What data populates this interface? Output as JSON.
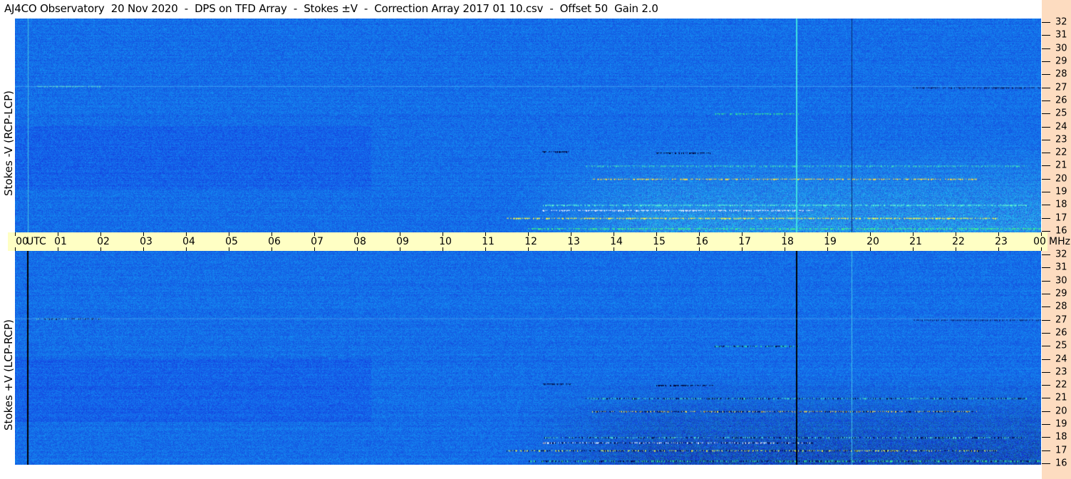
{
  "title": "AJ4CO Observatory  20 Nov 2020  -  DPS on TFD Array  -  Stokes ±V  -  Correction Array 2017 01 10.csv  -  Offset 50  Gain 2.0",
  "chart_data": [
    {
      "type": "heatmap",
      "ylabel": "Stokes -V (RCP-LCP)",
      "x_ticks": [
        "00",
        "01",
        "02",
        "03",
        "04",
        "05",
        "06",
        "07",
        "08",
        "09",
        "10",
        "11",
        "12",
        "13",
        "14",
        "15",
        "16",
        "17",
        "18",
        "19",
        "20",
        "21",
        "22",
        "23",
        "00"
      ],
      "x_unit": "UTC",
      "xlim": [
        "00",
        "24"
      ],
      "y_ticks": [
        32,
        31,
        30,
        29,
        28,
        27,
        26,
        25,
        24,
        23,
        22,
        21,
        20,
        19,
        18,
        17,
        16
      ],
      "y_unit": "MHz",
      "ylim": [
        16,
        32
      ],
      "colors": {
        "background": "#1f6fe8",
        "bright": "#7fe0ff",
        "hot": "#ffff40",
        "dark": "#000040"
      }
    },
    {
      "type": "heatmap",
      "ylabel": "Stokes +V (LCP-RCP)",
      "x_ticks": [
        "00",
        "01",
        "02",
        "03",
        "04",
        "05",
        "06",
        "07",
        "08",
        "09",
        "10",
        "11",
        "12",
        "13",
        "14",
        "15",
        "16",
        "17",
        "18",
        "19",
        "20",
        "21",
        "22",
        "23",
        "00"
      ],
      "x_unit": "UTC",
      "xlim": [
        "00",
        "24"
      ],
      "y_ticks": [
        32,
        31,
        30,
        29,
        28,
        27,
        26,
        25,
        24,
        23,
        22,
        21,
        20,
        19,
        18,
        17,
        16
      ],
      "y_unit": "MHz",
      "ylim": [
        16,
        32
      ],
      "colors": {
        "background": "#1f6fe8",
        "bright": "#7fe0ff",
        "hot": "#ffff40",
        "dark": "#000040"
      }
    }
  ]
}
